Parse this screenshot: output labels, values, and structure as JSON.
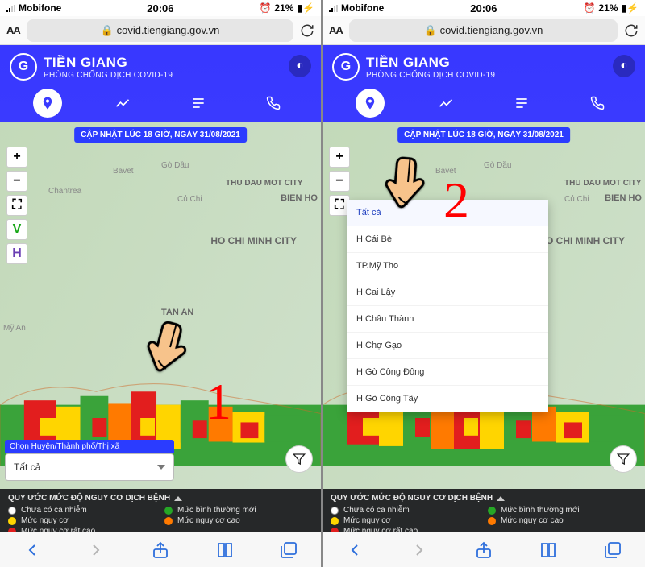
{
  "status": {
    "carrier": "Mobifone",
    "time": "20:06",
    "battery": "21%"
  },
  "browser": {
    "url": "covid.tiengiang.gov.vn",
    "font_toggle": "AA"
  },
  "header": {
    "title": "TIỀN GIANG",
    "subtitle": "PHÒNG CHỐNG DỊCH COVID-19"
  },
  "update_badge": "CẬP NHẬT LÚC 18 GIỜ, NGÀY 31/08/2021",
  "map_controls": {
    "v": "V",
    "h": "H"
  },
  "map_labels": {
    "chantrea": "Chantrea",
    "bavet": "Bavet",
    "godau": "Gò Dầu",
    "cuchi": "Củ Chi",
    "thudau": "THU DAU MOT CITY",
    "bienho": "BIEN HO",
    "hcmc": "HO CHI MINH CITY",
    "tanan": "TAN AN",
    "myan": "Mỹ An"
  },
  "selector": {
    "label": "Chọn Huyện/Thành phố/Thị xã",
    "value": "Tất cả"
  },
  "district_options": [
    "Tất cả",
    "H.Cái Bè",
    "TP.Mỹ Tho",
    "H.Cai Lậy",
    "H.Châu Thành",
    "H.Chợ Gạo",
    "H.Gò Công Đông",
    "H.Gò Công Tây"
  ],
  "legend": {
    "title": "QUY ƯỚC MỨC ĐỘ NGUY CƠ DỊCH BỆNH",
    "items": [
      {
        "color": "#ffffff",
        "label": "Chưa có ca nhiễm"
      },
      {
        "color": "#26a726",
        "label": "Mức bình thường mới"
      },
      {
        "color": "#ffd500",
        "label": "Mức nguy cơ"
      },
      {
        "color": "#ff7a00",
        "label": "Mức nguy cơ cao"
      },
      {
        "color": "#e21e1e",
        "label": "Mức nguy cơ rất cao"
      }
    ]
  },
  "steps": {
    "one": "1",
    "two": "2"
  }
}
